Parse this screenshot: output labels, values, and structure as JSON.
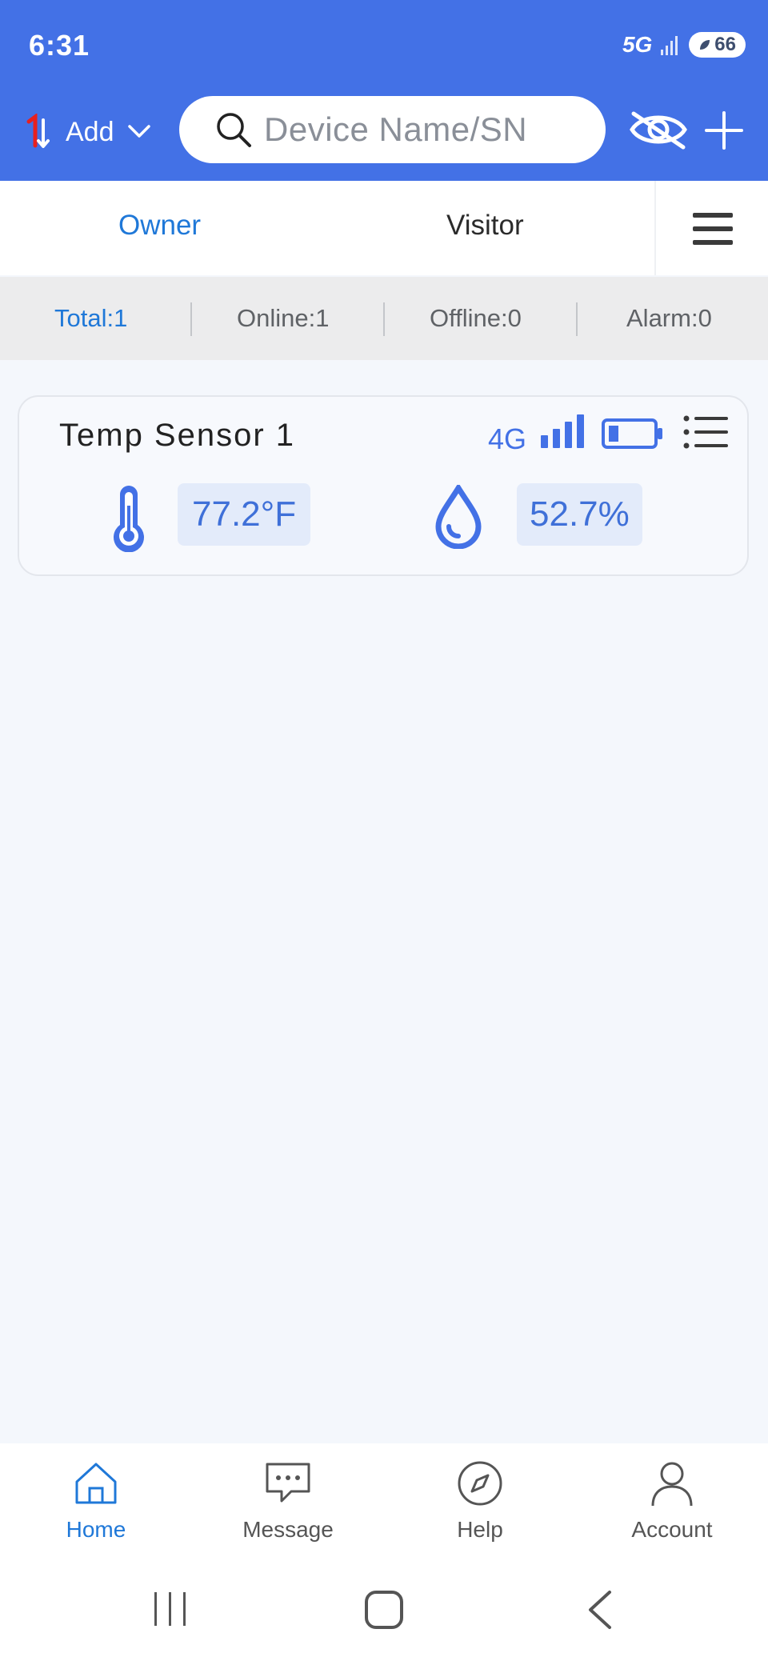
{
  "status_bar": {
    "time": "6:31",
    "network": "5G",
    "battery": "66"
  },
  "header": {
    "add_label": "Add",
    "search_placeholder": "Device Name/SN",
    "colors": {
      "header_bg": "#4371e6",
      "accent": "#1f78d8"
    }
  },
  "tabs": [
    {
      "label": "Owner",
      "active": true
    },
    {
      "label": "Visitor",
      "active": false
    }
  ],
  "counts": {
    "total": "Total:1",
    "online": "Online:1",
    "offline": "Offline:0",
    "alarm": "Alarm:0"
  },
  "devices": [
    {
      "name": "Temp Sensor 1",
      "network": "4G",
      "temperature": "77.2°F",
      "humidity": "52.7%"
    }
  ],
  "bottom_nav": [
    {
      "label": "Home",
      "icon": "home-icon",
      "active": true
    },
    {
      "label": "Message",
      "icon": "message-icon",
      "active": false
    },
    {
      "label": "Help",
      "icon": "compass-icon",
      "active": false
    },
    {
      "label": "Account",
      "icon": "user-icon",
      "active": false
    }
  ]
}
